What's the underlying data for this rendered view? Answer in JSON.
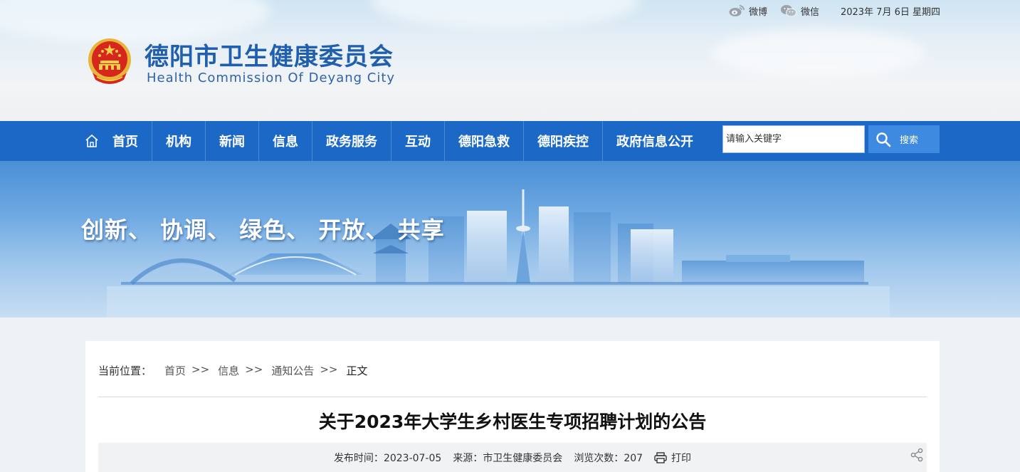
{
  "topbar": {
    "weibo_label": "微博",
    "wechat_label": "微信",
    "date": "2023年 7月 6日 星期四"
  },
  "site": {
    "title": "德阳市卫生健康委员会",
    "subtitle": "Health Commission Of Deyang City"
  },
  "nav": {
    "items": [
      {
        "label": "首页"
      },
      {
        "label": "机构"
      },
      {
        "label": "新闻"
      },
      {
        "label": "信息"
      },
      {
        "label": "政务服务"
      },
      {
        "label": "互动"
      },
      {
        "label": "德阳急救"
      },
      {
        "label": "德阳疾控"
      },
      {
        "label": "政府信息公开"
      }
    ]
  },
  "search": {
    "placeholder": "请输入关键字",
    "button_label": "搜索"
  },
  "banner": {
    "slogan": "创新、 协调、 绿色、 开放、 共享"
  },
  "breadcrumb": {
    "label": "当前位置：",
    "items": [
      "首页",
      "信息",
      "通知公告",
      "正文"
    ],
    "separator": ">>"
  },
  "article": {
    "title": "关于2023年大学生乡村医生专项招聘计划的公告",
    "meta": {
      "publish_label": "发布时间：",
      "publish_date": "2023-07-05",
      "source_label": "来源：",
      "source": "市卫生健康委员会",
      "views_label": "浏览次数：",
      "views": "207",
      "print_label": "打印"
    }
  },
  "colors": {
    "nav_bg": "#1b68c6",
    "title_blue": "#1f5fae",
    "search_btn": "#3d8ae0"
  }
}
